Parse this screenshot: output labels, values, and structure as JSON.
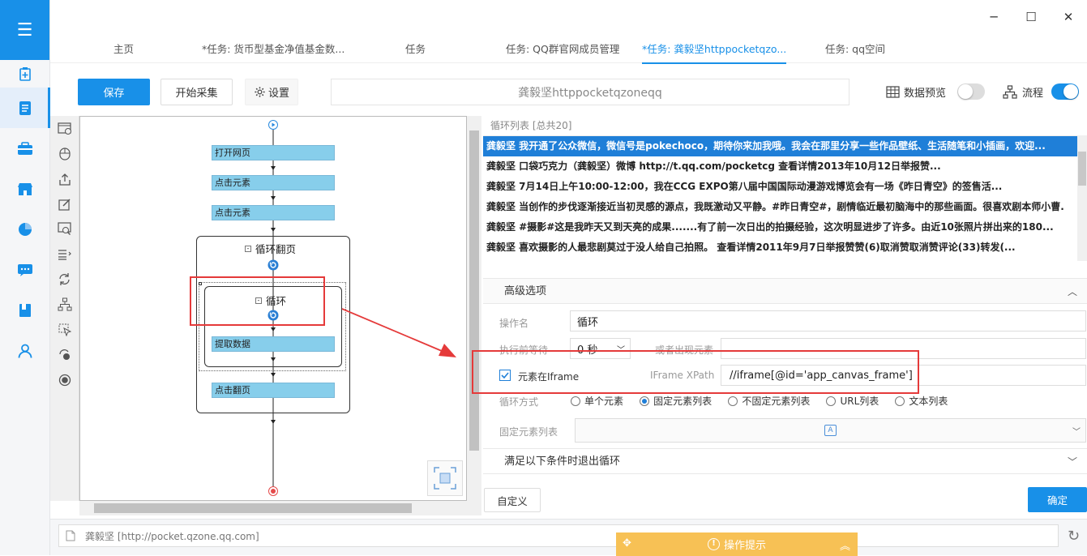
{
  "tabs": [
    {
      "label": "主页"
    },
    {
      "label": "*任务: 货币型基金净值基金数..."
    },
    {
      "label": "任务"
    },
    {
      "label": "任务: QQ群官网成员管理"
    },
    {
      "label": "*任务: 龚毅坚httppocketqzo..."
    },
    {
      "label": "任务: qq空间"
    }
  ],
  "toolbar": {
    "save": "保存",
    "start": "开始采集",
    "settings": "设置",
    "address": "龚毅坚httppocketqzoneqq",
    "preview": "数据预览",
    "flow": "流程"
  },
  "flow": {
    "open_page": "打开网页",
    "click1": "点击元素",
    "click2": "点击元素",
    "loop_page": "循环翻页",
    "loop": "循环",
    "extract": "提取数据",
    "next_page": "点击翻页"
  },
  "loop_list": {
    "header": "循环列表 [总共20]",
    "rows": [
      "龚毅坚  我开通了公众微信，微信号是pokechoco，期待你来加我哦。我会在那里分享一些作品壁纸、生活随笔和小插画，欢迎...",
      "龚毅坚  口袋巧克力（龚毅坚）微博 http://t.qq.com/pocketcg 查看详情2013年10月12日举报赞...",
      "龚毅坚  7月14日上午10:00-12:00，我在CCG EXPO第八届中国国际动漫游戏博览会有一场《昨日青空》的签售活...",
      "龚毅坚  当创作的步伐逐渐接近当初灵感的源点，我既激动又平静。#昨日青空#，剧情临近最初脑海中的那些画面。很喜欢剧本师小曹.",
      "龚毅坚  #摄影#这是我昨天又到天亮的成果.......有了前一次日出的拍摄经验，这次明显进步了许多。由近10张照片拼出来的180...",
      "龚毅坚  喜欢摄影的人最悲剧莫过于没人给自己拍照。  查看详情2011年9月7日举报赞赞(6)取消赞取消赞评论(33)转发(..."
    ]
  },
  "advanced": {
    "title": "高级选项",
    "op_name_label": "操作名",
    "op_name": "循环",
    "wait_label": "执行前等待",
    "wait_value": "0 秒",
    "or_label": "或者出现元素",
    "iframe_label": "元素在Iframe",
    "xpath_label": "IFrame XPath",
    "xpath": "//iframe[@id='app_canvas_frame']",
    "loop_mode_label": "循环方式",
    "modes": [
      "单个元素",
      "固定元素列表",
      "不固定元素列表",
      "URL列表",
      "文本列表"
    ],
    "fixed_list_label": "固定元素列表",
    "exit_title": "满足以下条件时退出循环",
    "custom": "自定义",
    "ok": "确定"
  },
  "status": {
    "url": "龚毅坚 [http://pocket.qzone.qq.com]",
    "hint": "操作提示"
  }
}
